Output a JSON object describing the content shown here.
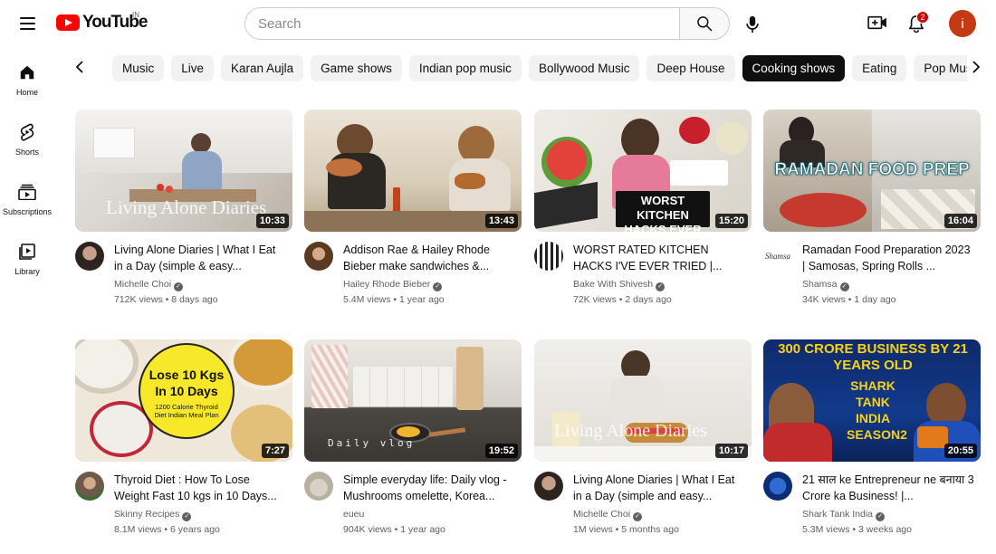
{
  "header": {
    "logo_text": "YouTube",
    "country_code": "IN",
    "search_placeholder": "Search",
    "notification_count": "2",
    "avatar_letter": "i"
  },
  "sidebar": {
    "items": [
      {
        "label": "Home",
        "icon": "home-icon"
      },
      {
        "label": "Shorts",
        "icon": "shorts-icon"
      },
      {
        "label": "Subscriptions",
        "icon": "subscriptions-icon"
      },
      {
        "label": "Library",
        "icon": "library-icon"
      }
    ]
  },
  "chips": [
    {
      "label": "Music"
    },
    {
      "label": "Live"
    },
    {
      "label": "Karan Aujla"
    },
    {
      "label": "Game shows"
    },
    {
      "label": "Indian pop music"
    },
    {
      "label": "Bollywood Music"
    },
    {
      "label": "Deep House"
    },
    {
      "label": "Cooking shows",
      "active": true
    },
    {
      "label": "Eating"
    },
    {
      "label": "Pop Music"
    }
  ],
  "videos": [
    {
      "title": "Living Alone Diaries | What I Eat in a Day (simple & easy...",
      "channel": "Michelle Choi",
      "views": "712K views",
      "age": "8 days ago",
      "duration": "10:33",
      "thumb_overlay": "Living Alone Diaries",
      "verified": true
    },
    {
      "title": "Addison Rae & Hailey Rhode Bieber make sandwiches &...",
      "channel": "Hailey Rhode Bieber",
      "views": "5.4M views",
      "age": "1 year ago",
      "duration": "13:43",
      "thumb_overlay": "",
      "verified": true
    },
    {
      "title": "WORST RATED KITCHEN HACKS I'VE EVER TRIED |...",
      "channel": "Bake With Shivesh",
      "views": "72K views",
      "age": "2 days ago",
      "duration": "15:20",
      "thumb_overlay": "WORST KITCHEN HACKS EVER",
      "verified": true
    },
    {
      "title": "Ramadan Food Preparation 2023 | Samosas, Spring Rolls ...",
      "channel": "Shamsa",
      "views": "34K views",
      "age": "1 day ago",
      "duration": "16:04",
      "thumb_overlay": "RAMADAN FOOD PREP",
      "verified": true
    },
    {
      "title": "Thyroid Diet : How To Lose Weight Fast 10 kgs in 10 Days...",
      "channel": "Skinny Recipes",
      "views": "8.1M views",
      "age": "6 years ago",
      "duration": "7:27",
      "thumb_overlay": "Lose 10 Kgs In 10 Days",
      "thumb_sub": "1200 Calorie Thyroid Diet Indian Meal Plan",
      "verified": true
    },
    {
      "title": "Simple everyday life: Daily vlog - Mushrooms omelette, Korea...",
      "channel": "eueu",
      "views": "904K views",
      "age": "1 year ago",
      "duration": "19:52",
      "thumb_overlay": "Daily vlog",
      "verified": false
    },
    {
      "title": "Living Alone Diaries | What I Eat in a Day (simple and easy...",
      "channel": "Michelle Choi",
      "views": "1M views",
      "age": "5 months ago",
      "duration": "10:17",
      "thumb_overlay": "Living Alone Diaries",
      "verified": true
    },
    {
      "title": "21 साल ke Entrepreneur ne बनाया 3 Crore ka Business! |...",
      "channel": "Shark Tank India",
      "views": "5.3M views",
      "age": "3 weeks ago",
      "duration": "20:55",
      "thumb_overlay": "300 CRORE BUSINESS BY 21 YEARS OLD",
      "thumb_sub": "SHARK TANK INDIA SEASON2",
      "verified": true
    }
  ],
  "shamsa_avatar_text": "Shamsa"
}
